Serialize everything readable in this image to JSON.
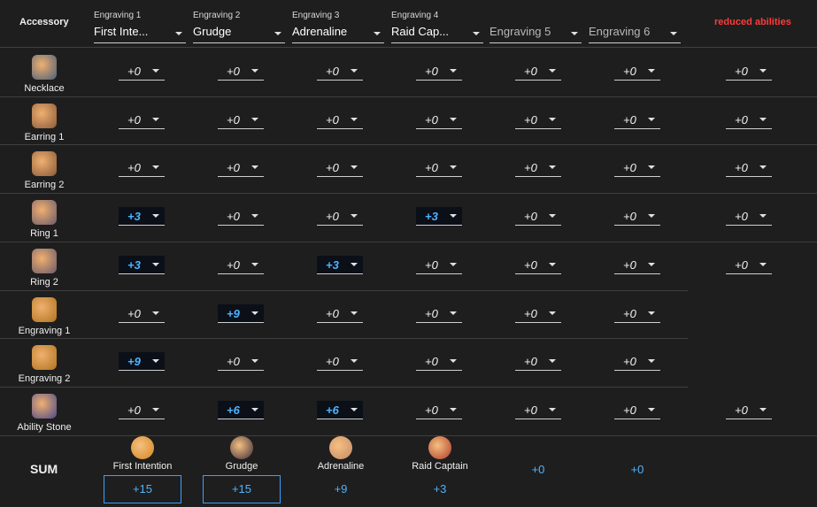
{
  "header": {
    "accessory_label": "Accessory",
    "reduced_label": "reduced abilities",
    "engravings": [
      {
        "label": "Engraving 1",
        "value": "First Inte..."
      },
      {
        "label": "Engraving 2",
        "value": "Grudge"
      },
      {
        "label": "Engraving 3",
        "value": "Adrenaline"
      },
      {
        "label": "Engraving 4",
        "value": "Raid Cap..."
      },
      {
        "label": "",
        "value": "Engraving 5"
      },
      {
        "label": "",
        "value": "Engraving 6"
      }
    ]
  },
  "rows": [
    {
      "name": "Necklace",
      "icon": "necklace-icon",
      "values": [
        "+0",
        "+0",
        "+0",
        "+0",
        "+0",
        "+0"
      ],
      "reduced": "+0"
    },
    {
      "name": "Earring 1",
      "icon": "earring-icon",
      "values": [
        "+0",
        "+0",
        "+0",
        "+0",
        "+0",
        "+0"
      ],
      "reduced": "+0"
    },
    {
      "name": "Earring 2",
      "icon": "earring-icon",
      "values": [
        "+0",
        "+0",
        "+0",
        "+0",
        "+0",
        "+0"
      ],
      "reduced": "+0"
    },
    {
      "name": "Ring 1",
      "icon": "ring-icon",
      "values": [
        "+3",
        "+0",
        "+0",
        "+3",
        "+0",
        "+0"
      ],
      "reduced": "+0"
    },
    {
      "name": "Ring 2",
      "icon": "ring-icon",
      "values": [
        "+3",
        "+0",
        "+3",
        "+0",
        "+0",
        "+0"
      ],
      "reduced": "+0"
    },
    {
      "name": "Engraving 1",
      "icon": "engraving-book-icon",
      "values": [
        "+0",
        "+9",
        "+0",
        "+0",
        "+0",
        "+0"
      ],
      "reduced": null
    },
    {
      "name": "Engraving 2",
      "icon": "engraving-book-icon",
      "values": [
        "+9",
        "+0",
        "+0",
        "+0",
        "+0",
        "+0"
      ],
      "reduced": null
    },
    {
      "name": "Ability Stone",
      "icon": "ability-stone-icon",
      "values": [
        "+0",
        "+6",
        "+6",
        "+0",
        "+0",
        "+0"
      ],
      "reduced": "+0"
    }
  ],
  "sum": {
    "label": "SUM",
    "items": [
      {
        "name": "First Intention",
        "icon": "first-intention-icon",
        "value": "+15",
        "boxed": true
      },
      {
        "name": "Grudge",
        "icon": "grudge-icon",
        "value": "+15",
        "boxed": true
      },
      {
        "name": "Adrenaline",
        "icon": "adrenaline-icon",
        "value": "+9",
        "boxed": false
      },
      {
        "name": "Raid Captain",
        "icon": "raid-captain-icon",
        "value": "+3",
        "boxed": false
      },
      {
        "name": "",
        "icon": "",
        "value": "+0",
        "boxed": false
      },
      {
        "name": "",
        "icon": "",
        "value": "+0",
        "boxed": false
      }
    ]
  },
  "colors": {
    "background": "#1e1e1e",
    "highlight_text": "#4fb3ff",
    "reduced_label": "#ff3b3b",
    "sum_box_border": "#3aa0ff"
  }
}
